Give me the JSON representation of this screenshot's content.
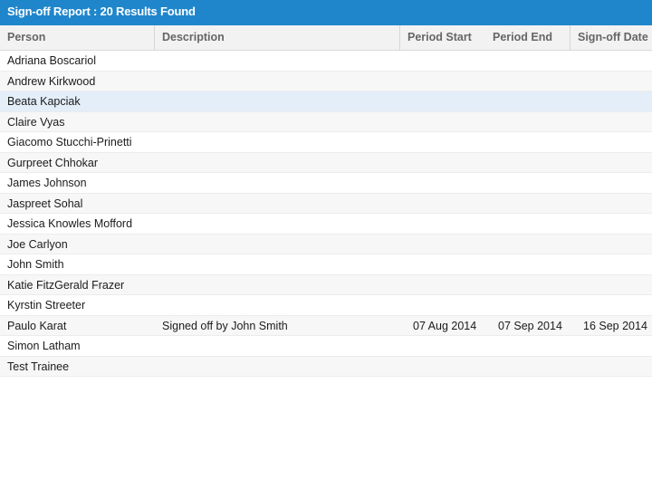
{
  "report": {
    "title": "Sign-off Report : 20 Results Found"
  },
  "columns": {
    "person": "Person",
    "description": "Description",
    "period_start": "Period Start",
    "period_end": "Period End",
    "signoff_date": "Sign-off Date"
  },
  "rows": [
    {
      "person": "Adriana Boscariol",
      "description": "",
      "period_start": "",
      "period_end": "",
      "signoff_date": ""
    },
    {
      "person": "Andrew Kirkwood",
      "description": "",
      "period_start": "",
      "period_end": "",
      "signoff_date": ""
    },
    {
      "person": "Beata Kapciak",
      "description": "",
      "period_start": "",
      "period_end": "",
      "signoff_date": "",
      "selected": true
    },
    {
      "person": "Claire Vyas",
      "description": "",
      "period_start": "",
      "period_end": "",
      "signoff_date": ""
    },
    {
      "person": "Giacomo Stucchi-Prinetti",
      "description": "",
      "period_start": "",
      "period_end": "",
      "signoff_date": ""
    },
    {
      "person": "Gurpreet Chhokar",
      "description": "",
      "period_start": "",
      "period_end": "",
      "signoff_date": ""
    },
    {
      "person": "James Johnson",
      "description": "",
      "period_start": "",
      "period_end": "",
      "signoff_date": ""
    },
    {
      "person": "Jaspreet Sohal",
      "description": "",
      "period_start": "",
      "period_end": "",
      "signoff_date": ""
    },
    {
      "person": "Jessica Knowles Mofford",
      "description": "",
      "period_start": "",
      "period_end": "",
      "signoff_date": ""
    },
    {
      "person": "Joe Carlyon",
      "description": "",
      "period_start": "",
      "period_end": "",
      "signoff_date": ""
    },
    {
      "person": "John Smith",
      "description": "",
      "period_start": "",
      "period_end": "",
      "signoff_date": ""
    },
    {
      "person": "Katie FitzGerald Frazer",
      "description": "",
      "period_start": "",
      "period_end": "",
      "signoff_date": ""
    },
    {
      "person": "Kyrstin Streeter",
      "description": "",
      "period_start": "",
      "period_end": "",
      "signoff_date": ""
    },
    {
      "person": "Paulo Karat",
      "description": "Signed off by John Smith",
      "period_start": "07 Aug 2014",
      "period_end": "07 Sep 2014",
      "signoff_date": "16 Sep 2014"
    },
    {
      "person": "Simon Latham",
      "description": "",
      "period_start": "",
      "period_end": "",
      "signoff_date": ""
    },
    {
      "person": "Test Trainee",
      "description": "",
      "period_start": "",
      "period_end": "",
      "signoff_date": ""
    }
  ],
  "colors": {
    "title_bar": "#1f86cc",
    "header_bg": "#f2f2f2",
    "alt_row": "#f7f7f7",
    "selected_row": "#e3eef9"
  }
}
